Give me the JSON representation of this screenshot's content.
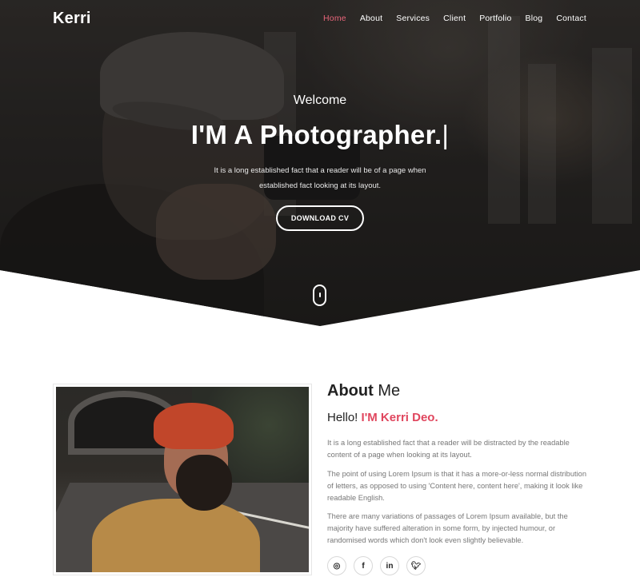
{
  "brand": {
    "logo": "Kerri",
    "accent_color": "#e0465e"
  },
  "nav": {
    "items": [
      {
        "label": "Home",
        "active": true
      },
      {
        "label": "About"
      },
      {
        "label": "Services"
      },
      {
        "label": "Client"
      },
      {
        "label": "Portfolio"
      },
      {
        "label": "Blog"
      },
      {
        "label": "Contact"
      }
    ]
  },
  "hero": {
    "welcome": "Welcome",
    "headline": "I'M A Photographer.",
    "cursor": "|",
    "description": "It is a long established fact that a reader will be of a page when established fact looking at its layout.",
    "cta_label": "DOWNLOAD CV",
    "scroll_icon": "mouse-scroll-icon"
  },
  "about": {
    "title_bold": "About",
    "title_light": "Me",
    "hello": "Hello!",
    "name": "I'M Kerri Deo.",
    "paragraphs": [
      "It is a long established fact that a reader will be distracted by the readable content of a page when looking at its layout.",
      "The point of using Lorem Ipsum is that it has a more-or-less normal distribution of letters, as opposed to using 'Content here, content here', making it look like readable English.",
      "There are many variations of passages of Lorem Ipsum available, but the majority have suffered alteration in some form, by injected humour, or randomised words which don't look even slightly believable."
    ],
    "socials": [
      {
        "icon": "dribbble-icon",
        "glyph": "◎"
      },
      {
        "icon": "facebook-icon",
        "glyph": "f"
      },
      {
        "icon": "linkedin-icon",
        "glyph": "in"
      },
      {
        "icon": "twitter-icon",
        "glyph": "🐦︎"
      }
    ]
  }
}
